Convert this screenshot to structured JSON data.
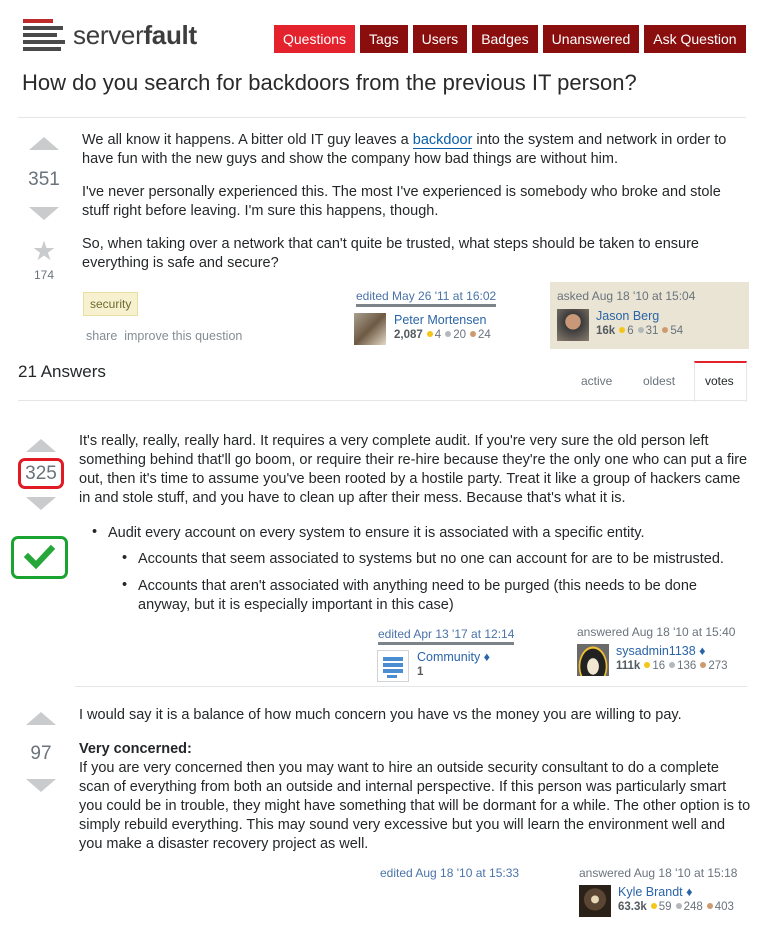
{
  "header": {
    "logo_prefix": "server",
    "logo_suffix": "fault",
    "nav": [
      "Questions",
      "Tags",
      "Users",
      "Badges",
      "Unanswered",
      "Ask Question"
    ]
  },
  "question": {
    "title": "How do you search for backdoors from the previous IT person?",
    "votes": "351",
    "favorites": "174",
    "p1_before": "We all know it happens. A bitter old IT guy leaves a ",
    "p1_link": "backdoor",
    "p1_after": " into the system and network in order to have fun with the new guys and show the company how bad things are without him.",
    "p2": "I've never personally experienced this. The most I've experienced is somebody who broke and stole stuff right before leaving. I'm sure this happens, though.",
    "p3": "So, when taking over a network that can't quite be trusted, what steps should be taken to ensure everything is safe and secure?",
    "tag": "security",
    "share": "share",
    "improve": "improve this question",
    "edited": "edited May 26 '11 at 16:02",
    "editor": {
      "name": "Peter Mortensen",
      "rep": "2,087",
      "gold": "4",
      "silver": "20",
      "bronze": "24"
    },
    "asked": "asked Aug 18 '10 at 15:04",
    "asker": {
      "name": "Jason Berg",
      "rep": "16k",
      "gold": "6",
      "silver": "31",
      "bronze": "54"
    }
  },
  "answers_header": {
    "count": "21 Answers",
    "tabs": [
      "active",
      "oldest",
      "votes"
    ]
  },
  "answer1": {
    "votes": "325",
    "p1": "It's really, really, really hard. It requires a very complete audit. If you're very sure the old person left something behind that'll go boom, or require their re-hire because they're the only one who can put a fire out, then it's time to assume you've been rooted by a hostile party. Treat it like a group of hackers came in and stole stuff, and you have to clean up after their mess. Because that's what it is.",
    "li1": "Audit every account on every system to ensure it is associated with a specific entity.",
    "li1a": "Accounts that seem associated to systems but no one can account for are to be mistrusted.",
    "li1b": "Accounts that aren't associated with anything need to be purged (this needs to be done anyway, but it is especially important in this case)",
    "edited": "edited Apr 13 '17 at 12:14",
    "editor": {
      "name": "Community ♦",
      "rep": "1"
    },
    "answered": "answered Aug 18 '10 at 15:40",
    "author": {
      "name": "sysadmin1138 ♦",
      "rep": "111k",
      "gold": "16",
      "silver": "136",
      "bronze": "273"
    }
  },
  "answer2": {
    "votes": "97",
    "p1": "I would say it is a balance of how much concern you have vs the money you are willing to pay.",
    "heading": "Very concerned:",
    "p2": "If you are very concerned then you may want to hire an outside security consultant to do a complete scan of everything from both an outside and internal perspective. If this person was particularly smart you could be in trouble, they might have something that will be dormant for a while. The other option is to simply rebuild everything. This may sound very excessive but you will learn the environment well and you make a disaster recovery project as well.",
    "edited": "edited Aug 18 '10 at 15:33",
    "answered": "answered Aug 18 '10 at 15:18",
    "author": {
      "name": "Kyle Brandt ♦",
      "rep": "63.3k",
      "gold": "59",
      "silver": "248",
      "bronze": "403"
    }
  }
}
